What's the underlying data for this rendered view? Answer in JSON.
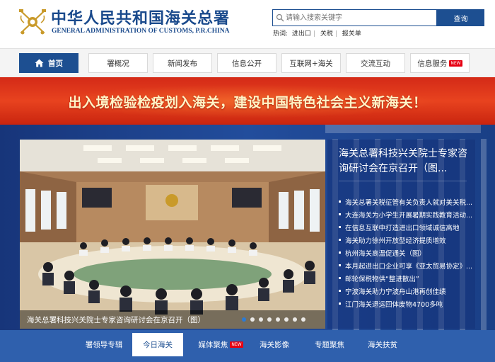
{
  "header": {
    "title_cn": "中华人民共和国海关总署",
    "title_en": "GENERAL ADMINISTRATION OF CUSTOMS, P.R.CHINA"
  },
  "search": {
    "placeholder": "请输入搜索关键字",
    "button_label": "查询",
    "hot_label": "热词:",
    "hot_words": [
      "进出口",
      "关税",
      "报关单"
    ]
  },
  "nav": {
    "items": [
      {
        "label": "首页",
        "active": true,
        "icon": "home-icon"
      },
      {
        "label": "署概况"
      },
      {
        "label": "新闻发布"
      },
      {
        "label": "信息公开"
      },
      {
        "label": "互联网+海关"
      },
      {
        "label": "交流互动"
      },
      {
        "label": "信息服务",
        "badge": "NEW"
      }
    ]
  },
  "banner": {
    "text": "出入境检验检疫划入海关，建设中国特色社会主义新海关！"
  },
  "carousel": {
    "caption": "海关总署科技兴关院士专家咨询研讨会在京召开（图）",
    "slide_count": 8,
    "active_index": 0
  },
  "headline": {
    "title": "海关总署科技兴关院士专家咨询研讨会在京召开（图..."
  },
  "news": {
    "items": [
      "海关总署关税征管有关负责人就对美关税...",
      "大连海关为小学生开展暑期实践教育活动...",
      "在信息互联中打造进出口领域诚信高地",
      "海关助力徐州开放型经济提质增效",
      "杭州海关高温促通关（图）",
      "本月起进出口企业可享《亚太贸易协定》...",
      "邮轮保税物供“整进散出”",
      "宁波海关助力宁波舟山港再创佳绩",
      "江门海关退运回体废物4700多吨"
    ]
  },
  "tabs": {
    "items": [
      {
        "label": "署领导专辑"
      },
      {
        "label": "今日海关",
        "active": true
      },
      {
        "label": "媒体聚焦",
        "badge": "NEW"
      },
      {
        "label": "海关影像"
      },
      {
        "label": "专题聚焦"
      },
      {
        "label": "海关扶贫"
      }
    ]
  },
  "colors": {
    "brand_blue": "#1d4f91",
    "banner_red": "#d42a17",
    "main_bg": "#1a3a7a",
    "tab_bar": "#2f60ad",
    "badge_red": "#e60012"
  }
}
